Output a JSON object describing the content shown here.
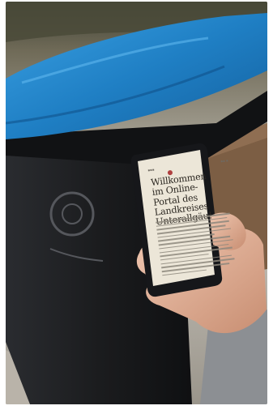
{
  "phone_screen": {
    "welcome_lines": [
      "Willkommen",
      "im Online-",
      "Portal des",
      "Landkreises",
      "Unterallgäu!"
    ],
    "body_line_count": 15
  },
  "colors": {
    "bin_lid": "#1f7fc4",
    "bin_body": "#1b1c1e",
    "screen": "#ece6d8",
    "phone": "#16171a",
    "skin": "#e2b49c"
  }
}
